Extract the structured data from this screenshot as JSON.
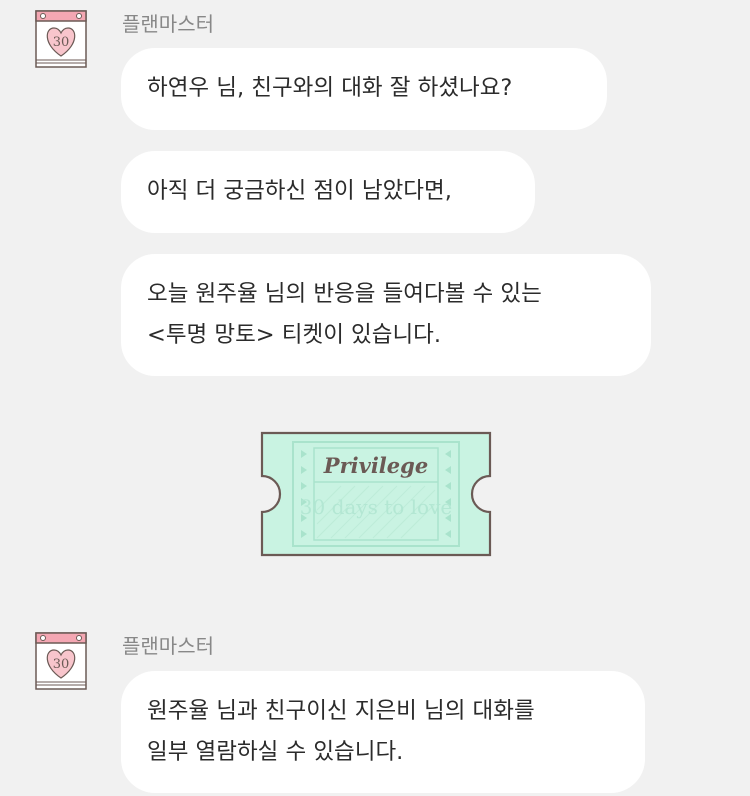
{
  "colors": {
    "background": "#f1f1f1",
    "bubble": "#ffffff",
    "text": "#2b2b2b",
    "sender": "#888888",
    "ticket_fill": "#c9f3e2",
    "ticket_border": "#6b5a55",
    "avatar_pink": "#f4a7b3"
  },
  "avatar": {
    "number": "30",
    "icon": "heart-calendar-icon"
  },
  "messages_top": {
    "sender": "플랜마스터",
    "bubbles": [
      {
        "lines": [
          "하연우 님, 친구와의 대화 잘 하셨나요?"
        ]
      },
      {
        "lines": [
          "아직 더 궁금하신 점이 남았다면,"
        ]
      },
      {
        "lines": [
          "오늘 원주율 님의 반응을 들여다볼 수 있는",
          "<투명 망토> 티켓이 있습니다."
        ]
      }
    ]
  },
  "ticket": {
    "title": "Privilege",
    "subtitle": "30 days to love",
    "icon": "ticket-icon"
  },
  "messages_bottom": {
    "sender": "플랜마스터",
    "bubbles": [
      {
        "lines": [
          "원주율 님과 친구이신 지은비 님의 대화를",
          "일부 열람하실 수 있습니다."
        ]
      }
    ]
  }
}
